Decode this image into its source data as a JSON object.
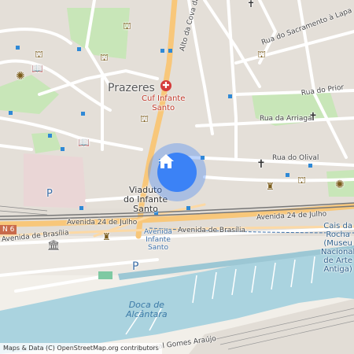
{
  "map": {
    "labels": {
      "prazeres": "Prazeres",
      "cuf_line1": "Cuf Infante",
      "cuf_line2": "Santo",
      "alto_da_cova": "Alto da Cova da Moura",
      "rua_sacramento": "Rua do Sacramento à Lapa",
      "rua_do_prior": "Rua do Prior",
      "rua_da_arriaga": "Rua da Arriaga",
      "rua_do_olival": "Rua do Olival",
      "viaduto_line1": "Viaduto",
      "viaduto_line2": "do Infante",
      "viaduto_line3": "Santo",
      "avenida_24_julho": "Avenida 24 de Julho",
      "avenida_24_julho_2": "Avenida 24 de Julho",
      "avenida_brasilia": "Avenida de Brasília",
      "avenida_brasilia_2": "Avenida de Brasília",
      "av_station_line1": "Avenida",
      "av_station_line2": "Infante",
      "av_station_line3": "Santo",
      "cais_line1": "Cais da",
      "cais_line2": "Rocha",
      "museu_line1": "(Museu",
      "museu_line2": "Nacional",
      "museu_line3": "de Arte",
      "museu_line4": "Antiga)",
      "doca_line1": "Doca de",
      "doca_line2": "Alcântara",
      "general_gomes": "General Gomes Araújo",
      "road_shield": "N 6",
      "parking": "P"
    },
    "attribution": "Maps & Data (C) OpenStreetMap.org contributors",
    "colors": {
      "background": "#f2efe9",
      "water": "#aad3df",
      "park": "#c8e6b8",
      "trunk_road": "#f8c77a",
      "location_pin": "#3b82f6",
      "hospital": "#d43b3b"
    }
  }
}
